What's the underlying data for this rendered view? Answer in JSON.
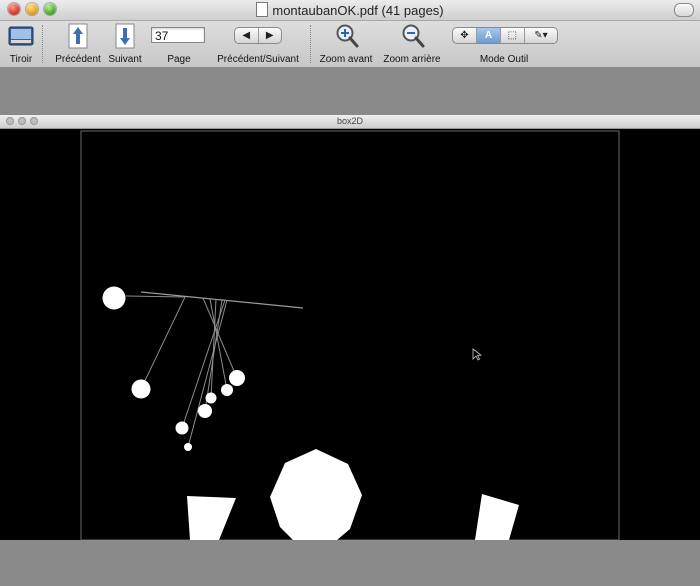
{
  "window": {
    "title": "montaubanOK.pdf (41 pages)"
  },
  "toolbar": {
    "drawer": {
      "label": "Tiroir",
      "icon": "drawer-icon"
    },
    "previous": {
      "label": "Précédent",
      "icon": "arrow-up-icon"
    },
    "next": {
      "label": "Suivant",
      "icon": "arrow-down-icon"
    },
    "page": {
      "label": "Page",
      "value": "37"
    },
    "prev_next": {
      "label": "Précédent/Suivant",
      "left": "◀",
      "right": "▶"
    },
    "zoom_in": {
      "label": "Zoom avant",
      "icon": "zoom-in-icon"
    },
    "zoom_out": {
      "label": "Zoom arrière",
      "icon": "zoom-out-icon"
    },
    "tool_mode": {
      "label": "Mode Outil",
      "move": "✥",
      "text": "A",
      "select": "⬚",
      "pen": "✎▾"
    }
  },
  "inner_window": {
    "title": "box2D"
  },
  "colors": {
    "accent": "#6d9ad1",
    "canvas_bg": "#000000",
    "shapes": "#ffffff",
    "ropes": "#9a9a9a"
  }
}
